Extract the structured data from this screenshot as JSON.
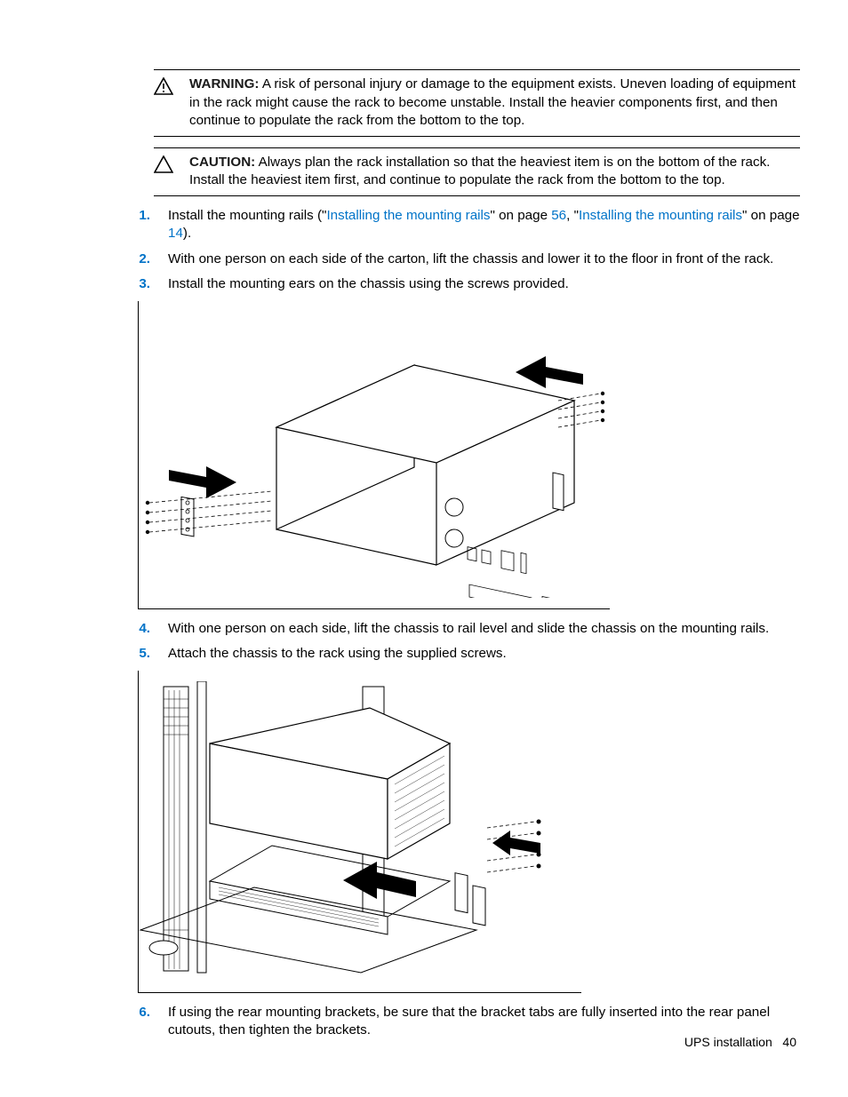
{
  "callouts": {
    "warning": {
      "label": "WARNING:",
      "text": "A risk of personal injury or damage to the equipment exists. Uneven loading of equipment in the rack might cause the rack to become unstable. Install the heavier components first, and then continue to populate the rack from the bottom to the top."
    },
    "caution": {
      "label": "CAUTION:",
      "text": "Always plan the rack installation so that the heaviest item is on the bottom of the rack. Install the heaviest item first, and continue to populate the rack from the bottom to the top."
    }
  },
  "steps": {
    "s1_pre": "Install the mounting rails (\"",
    "s1_link1": "Installing the mounting rails",
    "s1_mid1": "\" on page ",
    "s1_page1": "56",
    "s1_mid2": ", \"",
    "s1_link2": "Installing the mounting rails",
    "s1_mid3": "\" on page ",
    "s1_page2": "14",
    "s1_post": ").",
    "s2": "With one person on each side of the carton, lift the chassis and lower it to the floor in front of the rack.",
    "s3": "Install the mounting ears on the chassis using the screws provided.",
    "s4": "With one person on each side, lift the chassis to rail level and slide the chassis on the mounting rails.",
    "s5": "Attach the chassis to the rack using the supplied screws.",
    "s6": "If using the rear mounting brackets, be sure that the bracket tabs are fully inserted into the rear panel cutouts, then tighten the brackets."
  },
  "footer": {
    "section": "UPS installation",
    "page": "40"
  },
  "colors": {
    "link_blue": "#0073c8"
  }
}
